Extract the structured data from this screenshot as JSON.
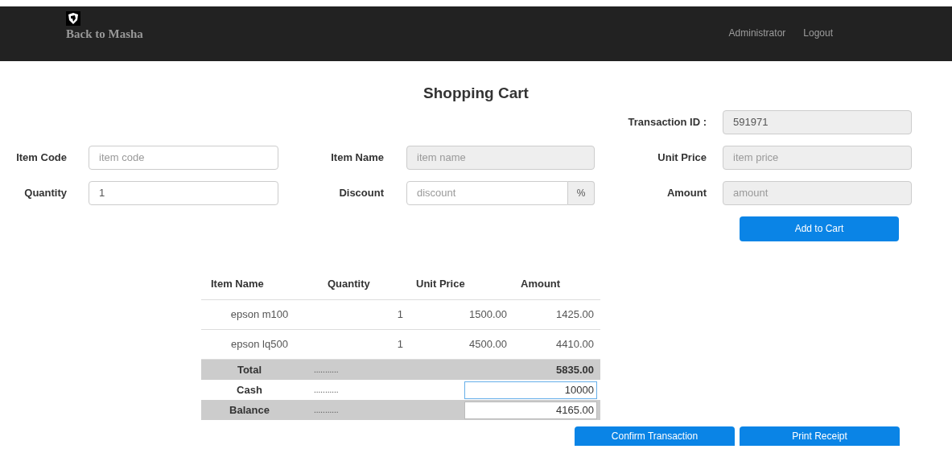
{
  "navbar": {
    "brand": "Back to Masha",
    "links": [
      "Administrator",
      "Logout"
    ]
  },
  "title": "Shopping Cart",
  "transaction": {
    "label": "Transaction ID :",
    "value": "591971",
    "disabled": true
  },
  "fields": [
    {
      "label": "Item Code",
      "placeholder": "item code",
      "disabled": false
    },
    {
      "label": "Item Name",
      "placeholder": "item name",
      "disabled": true
    },
    {
      "label": "Unit Price",
      "placeholder": "item price",
      "disabled": true
    },
    {
      "label": "Quantity",
      "value": "1",
      "disabled": false
    },
    {
      "label": "Discount",
      "placeholder": "discount",
      "disabled": false,
      "addon": "%"
    },
    {
      "label": "Amount",
      "placeholder": "amount",
      "disabled": true
    }
  ],
  "add_button": "Add to Cart",
  "table": {
    "columns": [
      "Item Name",
      "Quantity",
      "Unit Price",
      "Amount"
    ],
    "rows": [
      [
        "epson m100",
        "1",
        "1500.00",
        "1425.00"
      ],
      [
        "epson lq500",
        "1",
        "4500.00",
        "4410.00"
      ]
    ]
  },
  "summary": [
    {
      "kind": "text",
      "label": "Total",
      "dots": "...........",
      "value": "5835.00",
      "shaded": true
    },
    {
      "kind": "input",
      "label": "Cash",
      "dots": "...........",
      "value": "10000",
      "shaded": false,
      "focused": true
    },
    {
      "kind": "input",
      "label": "Balance",
      "dots": "...........",
      "value": "4165.00",
      "shaded": true,
      "focused": false
    }
  ],
  "actions": [
    "Confirm Transaction",
    "Print Receipt"
  ]
}
